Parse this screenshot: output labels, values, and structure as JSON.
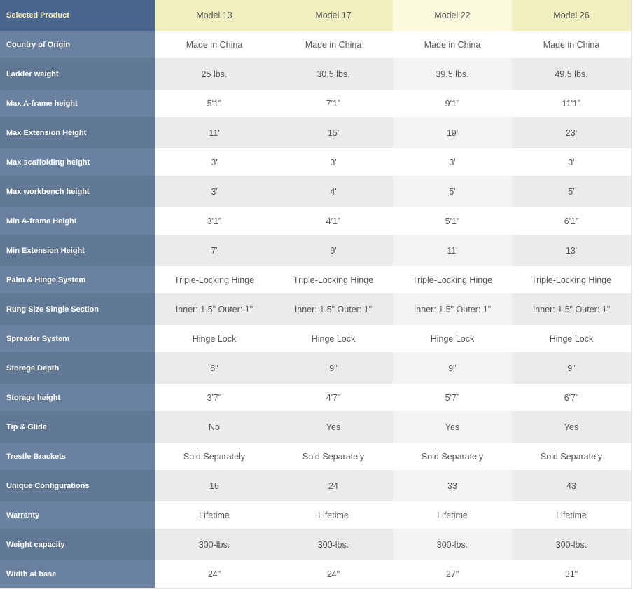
{
  "header": {
    "label": "Selected Product",
    "models": [
      "Model 13",
      "Model 17",
      "Model 22",
      "Model 26"
    ]
  },
  "colors": {
    "label_header_bg": "#4a658c",
    "label_header_text": "#f5efb0",
    "model_header_bg": "#f0efc0",
    "highlight_header_bg": "#fbfadc",
    "label_col_bg": "#6a819f"
  },
  "rows": [
    {
      "label": "Country of Origin",
      "values": [
        "Made in China",
        "Made in China",
        "Made in China",
        "Made in China"
      ]
    },
    {
      "label": "Ladder weight",
      "values": [
        "25 lbs.",
        "30.5 lbs.",
        "39.5 lbs.",
        "49.5 lbs."
      ]
    },
    {
      "label": "Max A-frame height",
      "values": [
        "5'1\"",
        "7'1\"",
        "9'1\"",
        "11'1\""
      ]
    },
    {
      "label": "Max Extension Height",
      "values": [
        "11'",
        "15'",
        "19'",
        "23'"
      ]
    },
    {
      "label": "Max scaffolding height",
      "values": [
        "3'",
        "3'",
        "3'",
        "3'"
      ]
    },
    {
      "label": "Max workbench height",
      "values": [
        "3'",
        "4'",
        "5'",
        "5'"
      ]
    },
    {
      "label": "Min A-frame Height",
      "values": [
        "3'1\"",
        "4'1\"",
        "5'1\"",
        "6'1\""
      ]
    },
    {
      "label": "Min Extension Height",
      "values": [
        "7'",
        "9'",
        "11'",
        "13'"
      ]
    },
    {
      "label": "Palm & Hinge System",
      "values": [
        "Triple-Locking Hinge",
        "Triple-Locking Hinge",
        "Triple-Locking Hinge",
        "Triple-Locking Hinge"
      ]
    },
    {
      "label": "Rung Size Single Section",
      "values": [
        "Inner: 1.5\" Outer: 1\"",
        "Inner: 1.5\" Outer: 1\"",
        "Inner: 1.5\" Outer: 1\"",
        "Inner: 1.5\" Outer: 1\""
      ]
    },
    {
      "label": "Spreader System",
      "values": [
        "Hinge Lock",
        "Hinge Lock",
        "Hinge Lock",
        "Hinge Lock"
      ]
    },
    {
      "label": "Storage Depth",
      "values": [
        "8\"",
        "9\"",
        "9\"",
        "9\""
      ]
    },
    {
      "label": "Storage height",
      "values": [
        "3'7\"",
        "4'7\"",
        "5'7\"",
        "6'7\""
      ]
    },
    {
      "label": "Tip & Glide",
      "values": [
        "No",
        "Yes",
        "Yes",
        "Yes"
      ]
    },
    {
      "label": "Trestle Brackets",
      "values": [
        "Sold Separately",
        "Sold Separately",
        "Sold Separately",
        "Sold Separately"
      ]
    },
    {
      "label": "Unique Configurations",
      "values": [
        "16",
        "24",
        "33",
        "43"
      ]
    },
    {
      "label": "Warranty",
      "values": [
        "Lifetime",
        "Lifetime",
        "Lifetime",
        "Lifetime"
      ]
    },
    {
      "label": "Weight capacity",
      "values": [
        "300-lbs.",
        "300-lbs.",
        "300-lbs.",
        "300-lbs."
      ]
    },
    {
      "label": "Width at base",
      "values": [
        "24\"",
        "24\"",
        "27\"",
        "31\""
      ]
    }
  ]
}
